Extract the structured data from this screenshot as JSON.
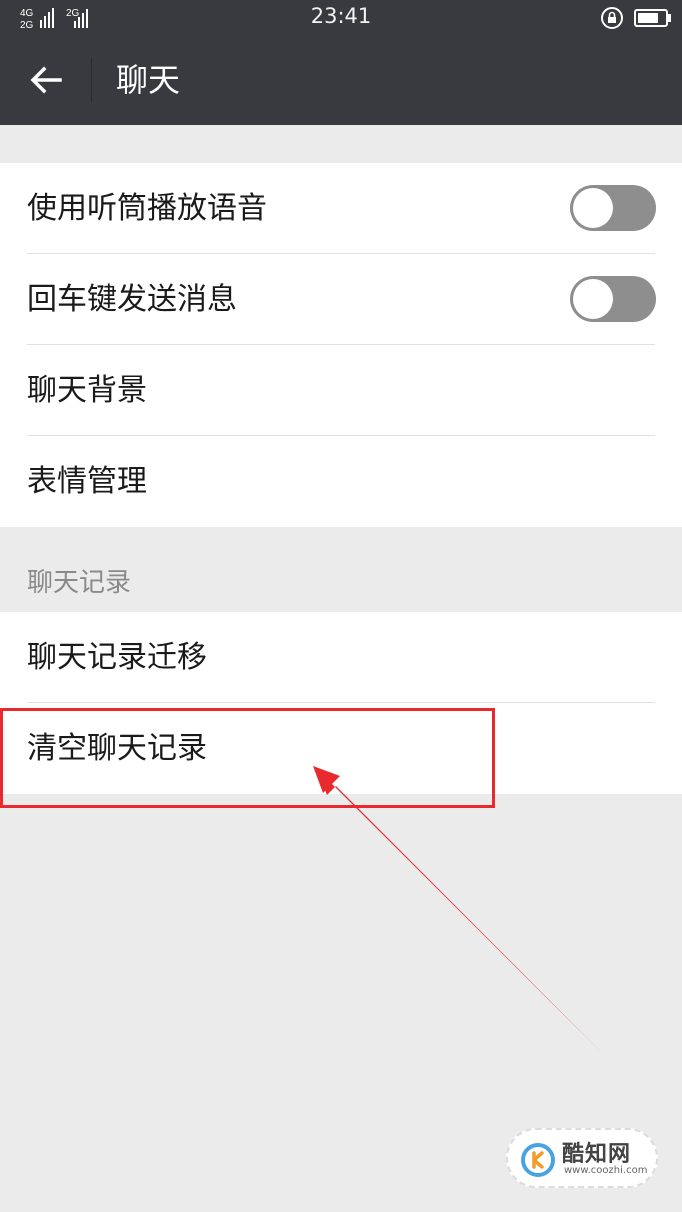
{
  "status_bar": {
    "network_top": "4G",
    "network_bottom": "2G",
    "network_second": "2G",
    "time": "23:41"
  },
  "app_bar": {
    "title": "聊天"
  },
  "settings": {
    "toggles": [
      {
        "label": "使用听筒播放语音",
        "enabled": false
      },
      {
        "label": "回车键发送消息",
        "enabled": false
      }
    ],
    "items": [
      {
        "label": "聊天背景"
      },
      {
        "label": "表情管理"
      }
    ]
  },
  "history_section": {
    "header": "聊天记录",
    "items": [
      {
        "label": "聊天记录迁移"
      },
      {
        "label": "清空聊天记录"
      }
    ]
  },
  "annotation": {
    "color": "#e8292e"
  },
  "watermark": {
    "name": "酷知网",
    "url": "www.coozhi.com"
  },
  "colors": {
    "appbar": "#393a3f",
    "background": "#ebebeb",
    "toggle_off": "#8e8e8e"
  }
}
